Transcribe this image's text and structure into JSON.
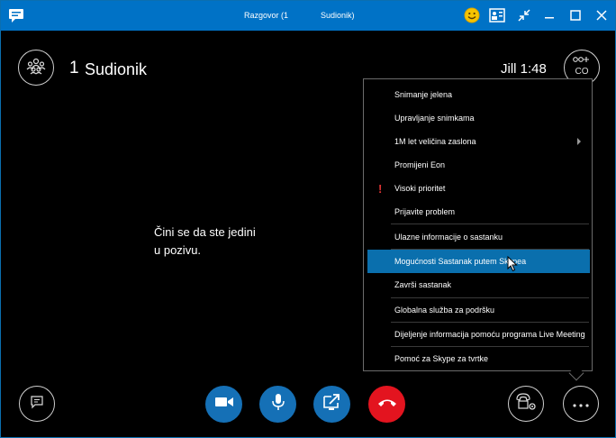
{
  "window": {
    "title_part1": "Razgovor (1",
    "title_part2": "Sudionik)"
  },
  "header": {
    "participant_count": "1",
    "participant_label": "Sudionik",
    "timer": "Jill 1:48",
    "add_people_label": "CO"
  },
  "main": {
    "status_line1": "Čini se da ste jedini",
    "status_line2": "u pozivu."
  },
  "menu": {
    "items": [
      {
        "label": "Snimanje jelena"
      },
      {
        "label": "Upravljanje snimkama"
      },
      {
        "label": "1M let veličina zaslona"
      },
      {
        "label": "Promijeni Eon"
      },
      {
        "label": "Visoki prioritet"
      },
      {
        "label": "Prijavite problem"
      },
      {
        "label": "Ulazne informacije o sastanku"
      },
      {
        "label": "Mogućnosti Sastanak putem Skypea"
      },
      {
        "label": "Završi sastanak"
      },
      {
        "label": "Globalna služba za podršku"
      },
      {
        "label": "Dijeljenje informacija pomoću programa Live Meeting"
      },
      {
        "label": "Pomoć za Skype za tvrtke"
      }
    ],
    "selected_index": 7,
    "warning_mark": "!"
  },
  "colors": {
    "titlebar": "#0072c6",
    "accent": "#1570b6",
    "hangup": "#e3141f",
    "selection": "#0a6fad"
  },
  "icons": {
    "app": "chat-bubble-icon",
    "participants": "participants-icon",
    "chat": "chat-icon",
    "video": "video-camera-icon",
    "mic": "microphone-icon",
    "share": "present-screen-icon",
    "hangup": "hang-up-icon",
    "devices": "call-controls-icon",
    "more": "more-options-icon"
  }
}
